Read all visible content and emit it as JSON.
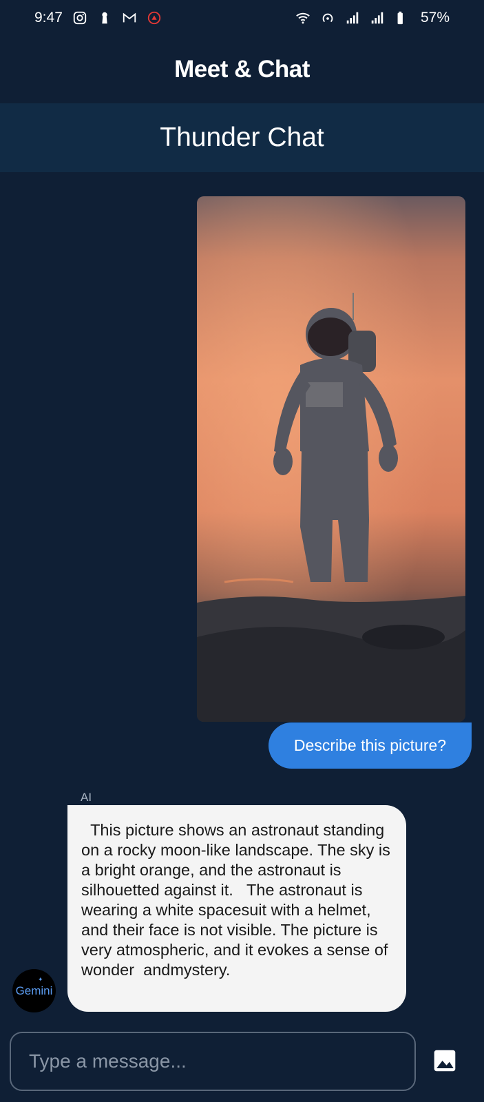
{
  "status_bar": {
    "time": "9:47",
    "battery": "57%",
    "left_icons": [
      "instagram-icon",
      "keyhole-icon",
      "gmail-icon",
      "app-notification-icon"
    ],
    "right_icons": [
      "wifi-icon",
      "hotspot-icon",
      "signal-icon",
      "signal-icon",
      "battery-icon"
    ]
  },
  "app_bar": {
    "title": "Meet & Chat"
  },
  "chat_header": {
    "title": "Thunder Chat"
  },
  "messages": {
    "user_image": {
      "icon": "astronaut-photo"
    },
    "user_text": "Describe this picture?",
    "ai_label": "AI",
    "ai_avatar_text": "Gemini",
    "ai_text": "  This picture shows an astronaut standing on a rocky moon-like landscape. The sky is a bright orange, and the astronaut is silhouetted against it.   The astronaut is wearing a white spacesuit with a helmet, and their face is not visible. The picture is very atmospheric, and it evokes a sense of wonder  andmystery."
  },
  "input": {
    "placeholder": "Type a message...",
    "attach_icon": "image-icon"
  },
  "colors": {
    "background": "#0f1f35",
    "header": "#112b45",
    "user_bubble": "#2f80e0",
    "ai_bubble": "#f4f4f4"
  }
}
